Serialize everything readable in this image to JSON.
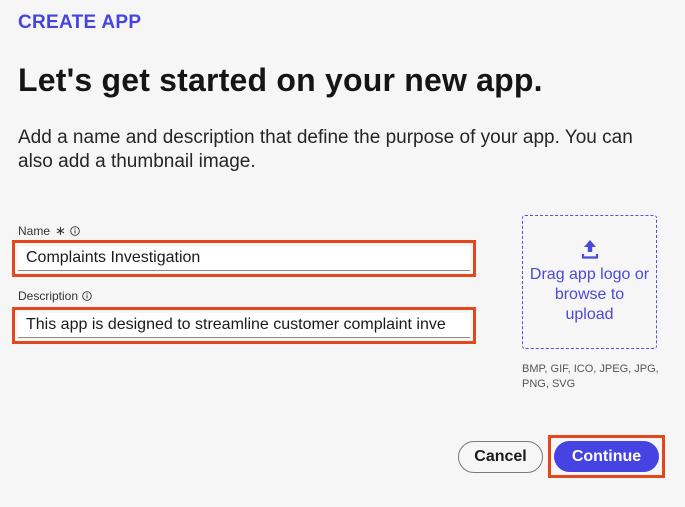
{
  "header": {
    "eyebrow": "CREATE APP",
    "title": "Let's get started on your new app.",
    "subtitle": "Add a name and description that define the purpose of your app. You can also add a thumbnail image."
  },
  "form": {
    "name": {
      "label": "Name",
      "required_mark": "∗",
      "value": "Complaints Investigation"
    },
    "description": {
      "label": "Description",
      "value": "This app is designed to streamline customer complaint inve"
    }
  },
  "upload": {
    "text": "Drag app logo or browse to upload",
    "formats": "BMP, GIF, ICO, JPEG, JPG, PNG, SVG"
  },
  "actions": {
    "cancel_label": "Cancel",
    "continue_label": "Continue"
  },
  "colors": {
    "accent": "#4643e3",
    "highlight": "#e4471c",
    "background": "#f6f6f6"
  },
  "icons": {
    "info": "info-icon",
    "upload": "upload-icon"
  }
}
